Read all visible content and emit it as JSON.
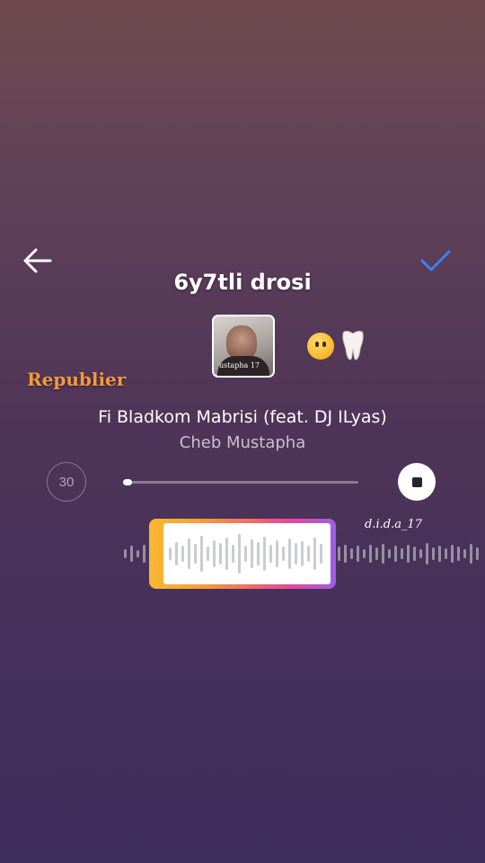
{
  "header": {
    "caption": "6y7tli drosi"
  },
  "stickers": {
    "emoji": [
      "face-without-mouth",
      "tooth"
    ],
    "cover_text": "ustapha 17"
  },
  "repost_label": "Republier",
  "track": {
    "title": "Fi Bladkom Mabrisi (feat. DJ ILyas)",
    "artist": "Cheb Mustapha"
  },
  "controls": {
    "duration": "30",
    "progress": 0.02
  },
  "watermark": "d.i.d.a_17",
  "colors": {
    "accent_check": "#3b82f6",
    "repost_label": "#f49a3c",
    "clip_gradient": [
      "#f8b733",
      "#f06b6a",
      "#e8489c",
      "#9c5ee6"
    ]
  },
  "icons": {
    "back": "back-arrow-icon",
    "confirm": "checkmark-icon",
    "stop": "stop-icon"
  }
}
